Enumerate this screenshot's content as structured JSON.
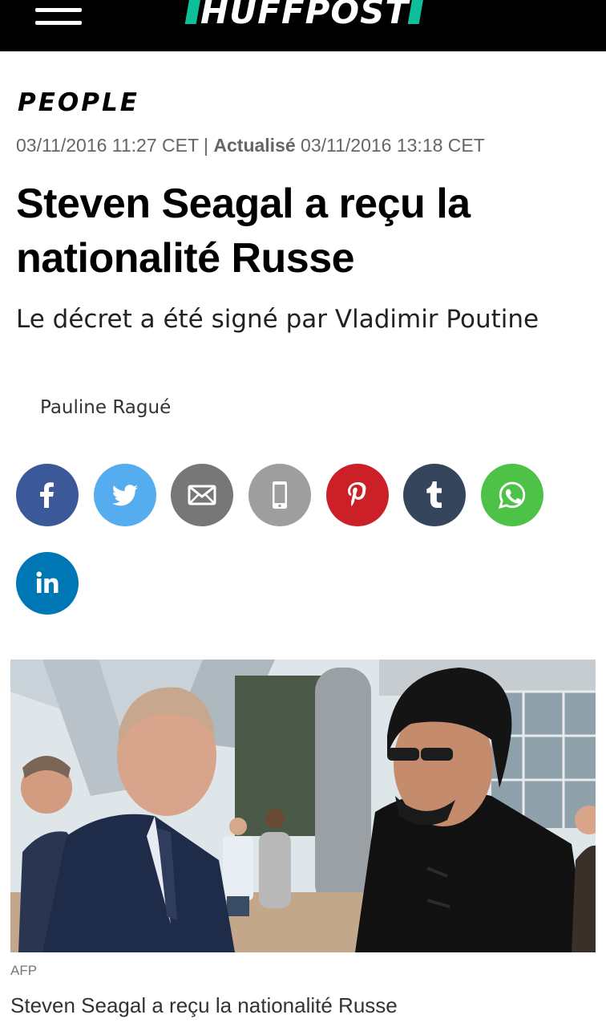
{
  "header": {
    "logo_text": "HUFFPOST",
    "background": "#000000",
    "accent": "#0dbe98",
    "menu_icon": "hamburger-menu-icon"
  },
  "article": {
    "category": "PEOPLE",
    "published": "03/11/2016 11:27 CET",
    "separator": "|",
    "updated_label": "Actualisé",
    "updated": "03/11/2016 13:18 CET",
    "headline": "Steven Seagal a reçu la nationalité Russe",
    "subheadline": "Le décret a été signé par Vladimir Poutine",
    "author": "Pauline Ragué"
  },
  "share_buttons": [
    {
      "name": "facebook",
      "icon": "facebook-icon",
      "color": "#3b5998"
    },
    {
      "name": "twitter",
      "icon": "twitter-icon",
      "color": "#55acee"
    },
    {
      "name": "email",
      "icon": "email-icon",
      "color": "#777777"
    },
    {
      "name": "sms",
      "icon": "mobile-phone-icon",
      "color": "#9e9e9e"
    },
    {
      "name": "pinterest",
      "icon": "pinterest-icon",
      "color": "#cb2027"
    },
    {
      "name": "tumblr",
      "icon": "tumblr-icon",
      "color": "#35465c"
    },
    {
      "name": "whatsapp",
      "icon": "whatsapp-icon",
      "color": "#4dc247"
    },
    {
      "name": "linkedin",
      "icon": "linkedin-icon",
      "color": "#0077b5"
    }
  ],
  "photo": {
    "credit": "AFP",
    "caption": "Steven Seagal a reçu la nationalité Russe"
  }
}
